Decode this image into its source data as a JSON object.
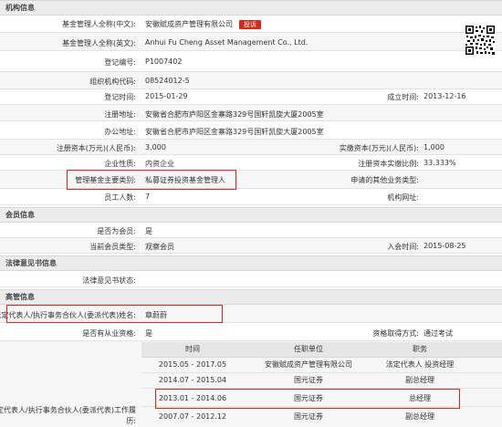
{
  "sections": {
    "org": "机构信息",
    "member": "会员信息",
    "legal_opinion": "法律意见书信息",
    "executives": "高管信息"
  },
  "org": {
    "name_cn_label": "基金管理人全称(中文):",
    "name_cn": "安徽赋成资产管理有限公司",
    "complaint_badge": "投诉",
    "name_en_label": "基金管理人全称(英文):",
    "name_en": "Anhui Fu Cheng Asset Management Co., Ltd.",
    "reg_no_label": "登记编号:",
    "reg_no": "P1007402",
    "org_code_label": "组织机构代码:",
    "org_code": "08524012-5",
    "reg_time_label": "登记时间:",
    "reg_time": "2015-01-29",
    "est_time_label": "成立时间:",
    "est_time": "2013-12-16",
    "reg_addr_label": "注册地址:",
    "reg_addr": "安徽省合肥市庐阳区金寨路329号国轩凯旋大厦2005室",
    "office_addr_label": "办公地址:",
    "office_addr": "安徽省合肥市庐阳区金寨路329号国轩凯旋大厦2005室",
    "reg_capital_label": "注册资本(万元)(人民币):",
    "reg_capital": "3,000",
    "paid_capital_label": "实缴资本(万元)(人民币):",
    "paid_capital": "1,000",
    "nature_label": "企业性质:",
    "nature": "内资企业",
    "paid_ratio_label": "注册资本实缴比例:",
    "paid_ratio": "33.333%",
    "biz_type_label": "管理基金主要类别:",
    "biz_type": "私募证券投资基金管理人",
    "other_biz_label": "申请的其他业务类型:",
    "other_biz": "",
    "staff_label": "员工人数:",
    "staff": "7",
    "website_label": "机构网址:",
    "website": ""
  },
  "member": {
    "is_member_label": "是否为会员:",
    "is_member": "是",
    "type_label": "当前会员类型:",
    "type": "观察会员",
    "join_time_label": "入会时间:",
    "join_time": "2015-08-25"
  },
  "legal_opinion": {
    "status_label": "法律意见书状态:",
    "status": ""
  },
  "executives": {
    "rep_label": "法定代表人/执行事务合伙人(委派代表)姓名:",
    "rep_name": "章蔚蔚",
    "qualified_label": "是否有从业资格:",
    "qualified": "是",
    "qual_method_label": "资格取得方式:",
    "qual_method": "通过考试",
    "history_label_1": "法定代表人/执行事务合伙人(委派代表)工作履",
    "history_label_2": "历:",
    "history_headers": [
      "时间",
      "任职单位",
      "职务"
    ],
    "history_rows": [
      [
        "2015.05 - 2017.05",
        "安徽赋成资产管理有限公司",
        "法定代表人 投资经理"
      ],
      [
        "2014.07 - 2015.04",
        "国元证券",
        "副总经理"
      ],
      [
        "2013.01 - 2014.06",
        "国元证券",
        "总经理"
      ],
      [
        "2007.07 - 2012.12",
        "国元证券",
        "副总经理"
      ]
    ]
  },
  "colors": {
    "highlight_box": "#d9241b",
    "badge": "#cf2b1f",
    "section_bg": "#ececec"
  }
}
